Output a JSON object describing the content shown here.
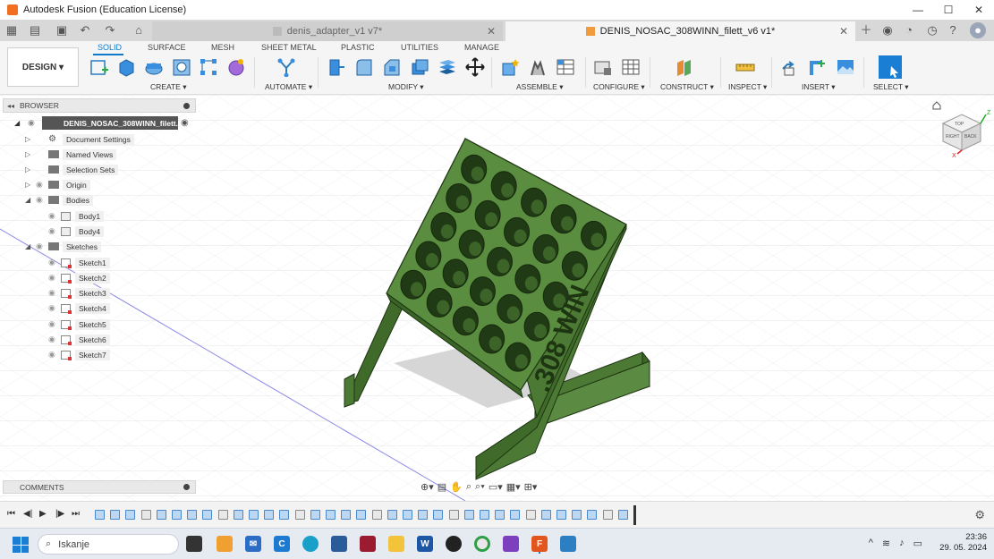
{
  "window": {
    "title": "Autodesk Fusion (Education License)",
    "minimize": "—",
    "maximize": "☐",
    "close": "✕"
  },
  "tabs": [
    {
      "label": "denis_adapter_v1 v7*",
      "active": false
    },
    {
      "label": "DENIS_NOSAC_308WINN_filett_v6 v1*",
      "active": true
    }
  ],
  "ribbon": {
    "workspace": "DESIGN",
    "tabs": [
      "SOLID",
      "SURFACE",
      "MESH",
      "SHEET METAL",
      "PLASTIC",
      "UTILITIES",
      "MANAGE"
    ],
    "groups": [
      "CREATE",
      "AUTOMATE",
      "MODIFY",
      "ASSEMBLE",
      "CONFIGURE",
      "CONSTRUCT",
      "INSPECT",
      "INSERT",
      "SELECT"
    ]
  },
  "browser": {
    "title": "BROWSER",
    "root": "DENIS_NOSAC_308WINN_filett...",
    "items": [
      {
        "label": "Document Settings"
      },
      {
        "label": "Named Views"
      },
      {
        "label": "Selection Sets"
      },
      {
        "label": "Origin"
      },
      {
        "label": "Bodies"
      },
      {
        "label": "Body1"
      },
      {
        "label": "Body4"
      },
      {
        "label": "Sketches"
      },
      {
        "label": "Sketch1"
      },
      {
        "label": "Sketch2"
      },
      {
        "label": "Sketch3"
      },
      {
        "label": "Sketch4"
      },
      {
        "label": "Sketch5"
      },
      {
        "label": "Sketch6"
      },
      {
        "label": "Sketch7"
      }
    ]
  },
  "model": {
    "engraving": ".308 WIN",
    "color": "#4c7a35"
  },
  "viewcube": {
    "front": "RIGHT",
    "top": "TOP",
    "side": "BACK",
    "axis_x": "X",
    "axis_z": "Z"
  },
  "comments": {
    "title": "COMMENTS"
  },
  "taskbar": {
    "search_placeholder": "Iskanje",
    "time": "23:36",
    "date": "29. 05. 2024"
  }
}
